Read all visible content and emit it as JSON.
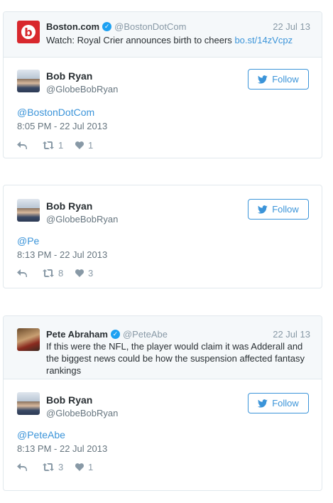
{
  "tweets": [
    {
      "quoted": {
        "name": "Boston.com",
        "handle": "@BostonDotCom",
        "date": "22 Jul 13",
        "text": "Watch: Royal Crier announces birth to cheers",
        "link": "bo.st/14zVcpz"
      },
      "author": {
        "name": "Bob Ryan",
        "handle": "@GlobeBobRyan"
      },
      "follow_label": "Follow",
      "reply_text": "@BostonDotCom",
      "timestamp": "8:05 PM - 22 Jul 2013",
      "retweets": "1",
      "likes": "1"
    },
    {
      "author": {
        "name": "Bob Ryan",
        "handle": "@GlobeBobRyan"
      },
      "follow_label": "Follow",
      "reply_text": "@Pe",
      "timestamp": "8:13 PM - 22 Jul 2013",
      "retweets": "8",
      "likes": "3"
    },
    {
      "quoted": {
        "name": "Pete Abraham",
        "handle": "@PeteAbe",
        "date": "22 Jul 13",
        "text": "If this were the NFL, the player would claim it was Adderall and the biggest news could be how the suspension affected fantasy rankings"
      },
      "author": {
        "name": "Bob Ryan",
        "handle": "@GlobeBobRyan"
      },
      "follow_label": "Follow",
      "reply_text": "@PeteAbe",
      "timestamp": "8:13 PM - 22 Jul 2013",
      "retweets": "3",
      "likes": "1"
    }
  ],
  "colors": {
    "link": "#3b94d9",
    "verified": "#1da1f2",
    "boston_red": "#d8282d"
  }
}
